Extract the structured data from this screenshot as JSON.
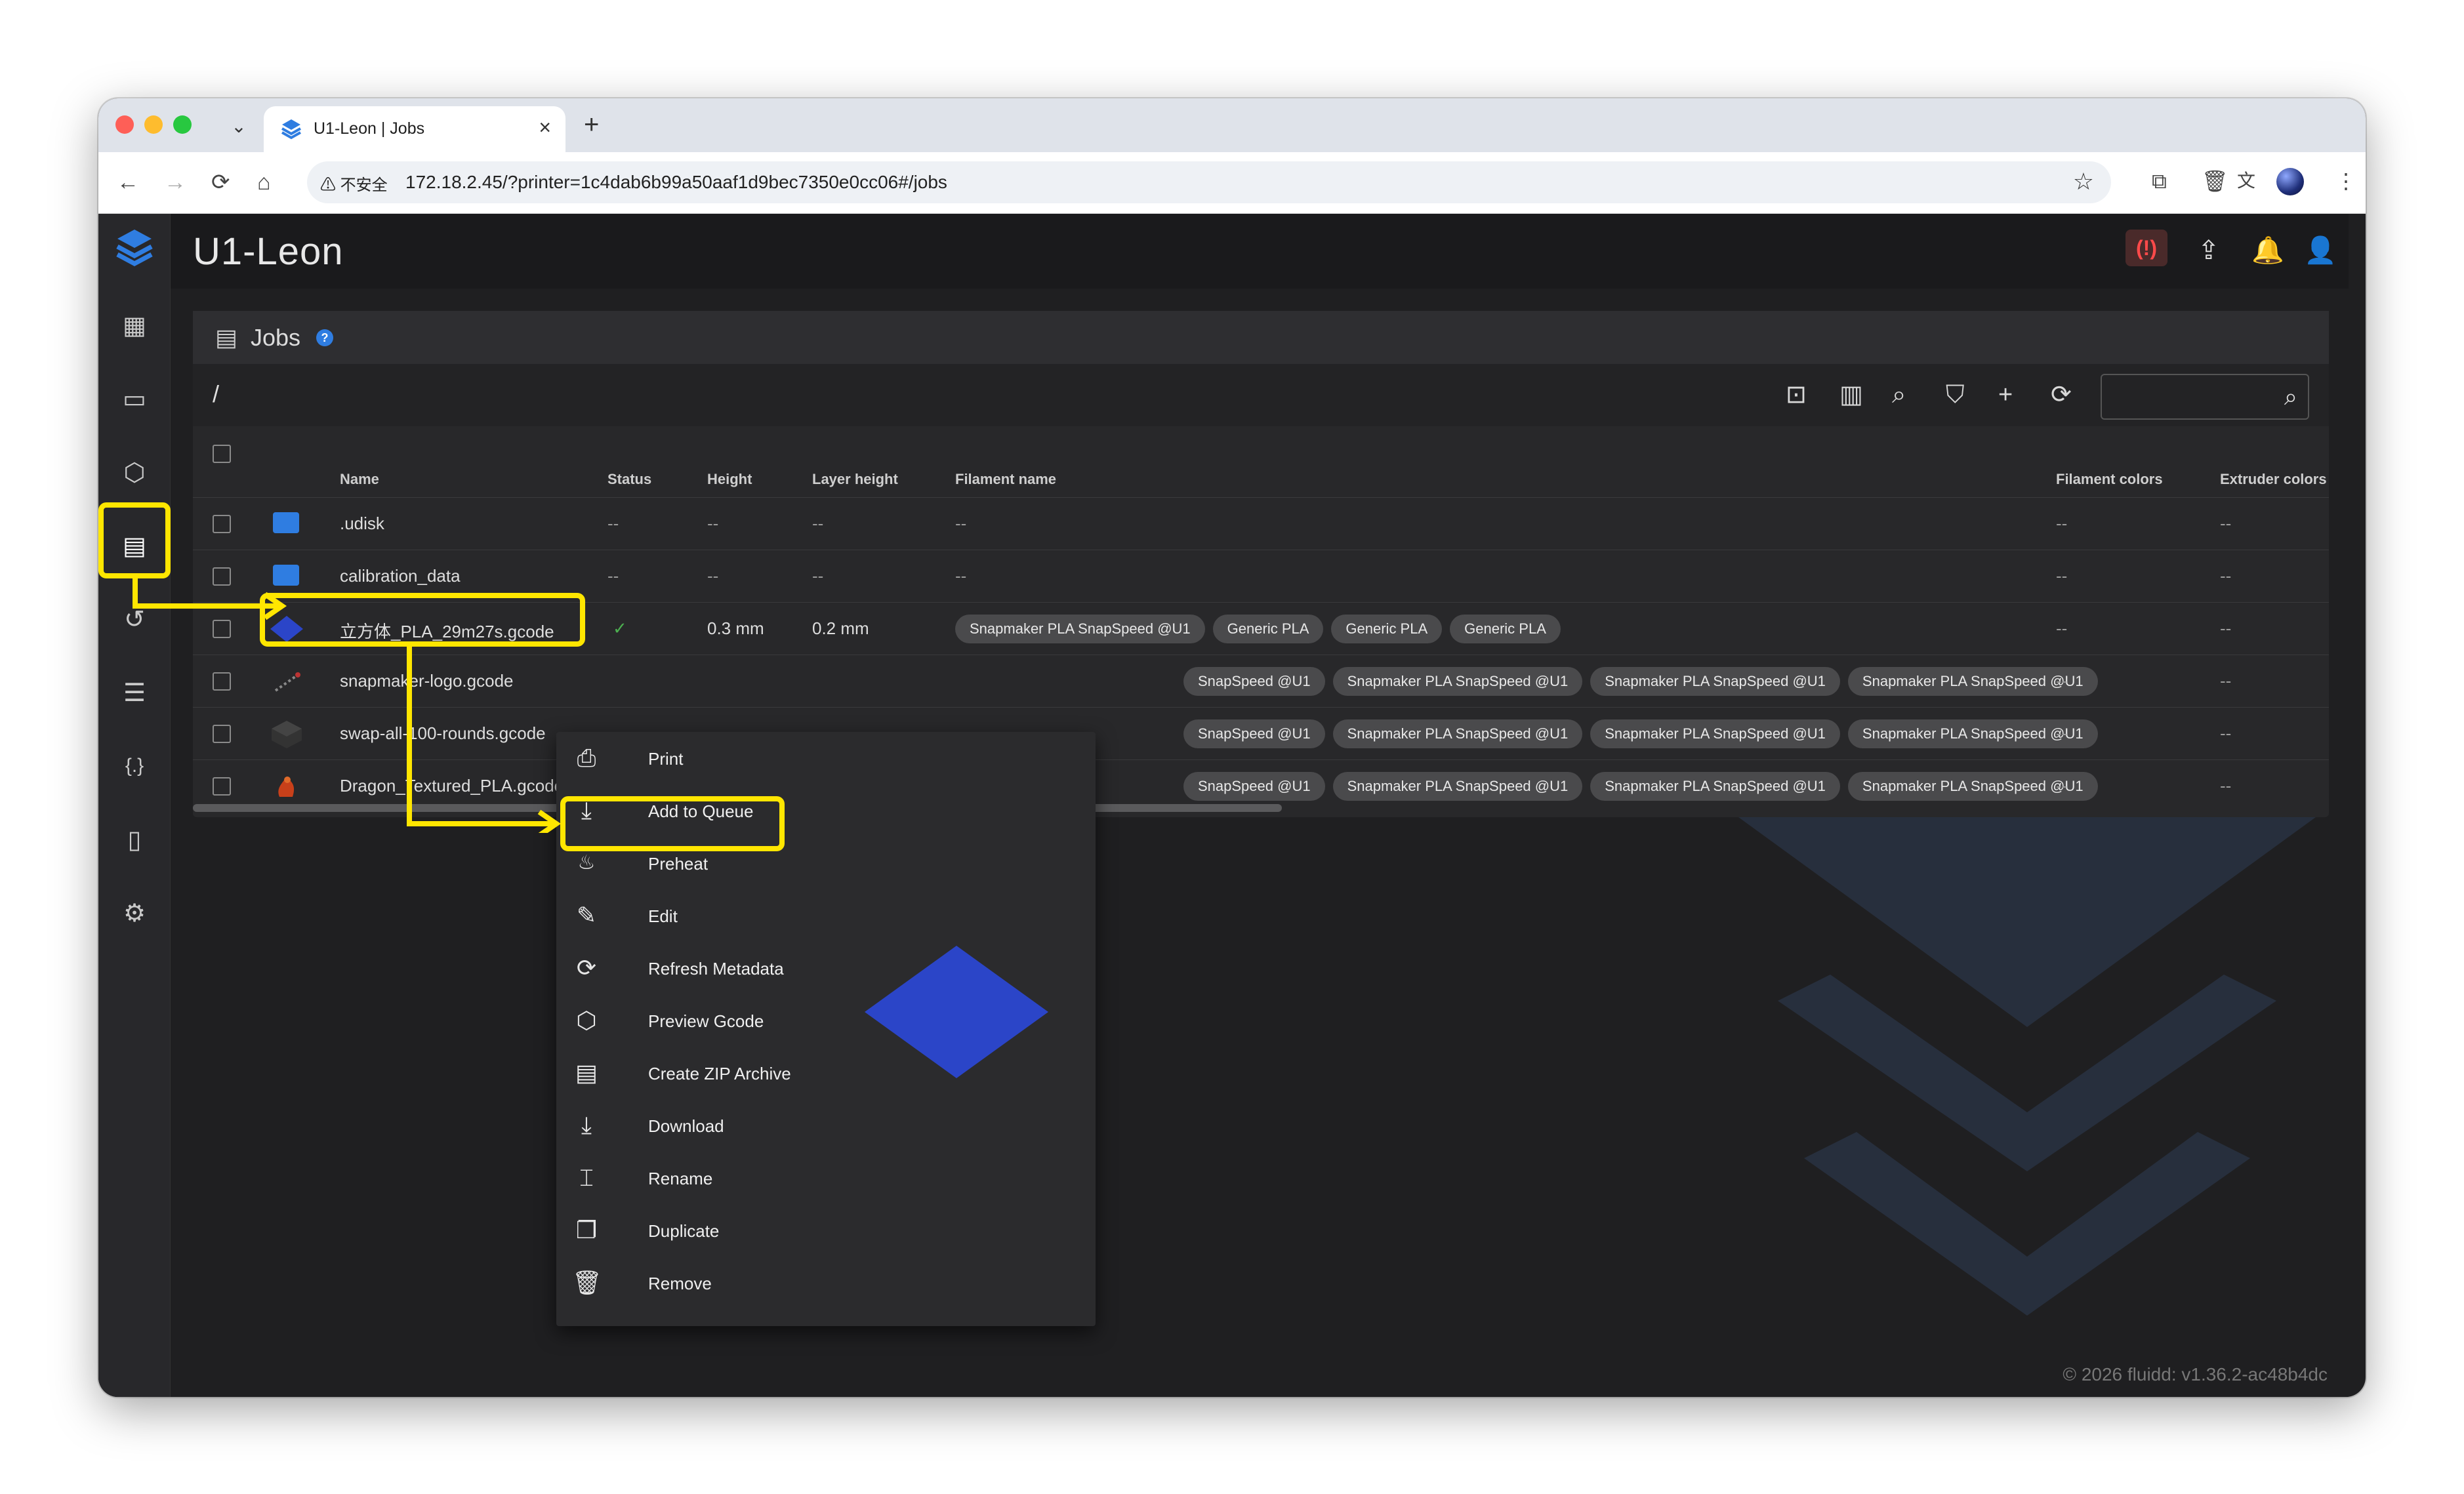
{
  "browser": {
    "tab_title": "U1-Leon | Jobs",
    "tab_close": "×",
    "new_tab": "+",
    "insecure_label": "⚠ 不安全",
    "url": "172.18.2.45/?printer=1c4dab6b99a50aaf1d9bec7350e0cc06#/jobs",
    "colors": {
      "red": "#fe5f57",
      "yellow": "#febc2e",
      "green": "#28c840"
    }
  },
  "app": {
    "title": "U1-Leon",
    "estop_icon": "emergency-stop-icon",
    "footer": "© 2026 fluidd: v1.36.2-ac48b4dc"
  },
  "sidebar": {
    "items": [
      {
        "name": "dashboard-icon"
      },
      {
        "name": "console-icon"
      },
      {
        "name": "gcode-preview-icon"
      },
      {
        "name": "jobs-icon",
        "active": true
      },
      {
        "name": "history-icon"
      },
      {
        "name": "tune-icon"
      },
      {
        "name": "macros-icon",
        "glyph": "{.}"
      },
      {
        "name": "printer-icon"
      },
      {
        "name": "settings-icon"
      }
    ]
  },
  "jobs": {
    "title": "Jobs",
    "help": "?",
    "path": "/",
    "columns": [
      "Name",
      "Status",
      "Height",
      "Layer height",
      "Filament name",
      "Filament colors",
      "Extruder colors"
    ],
    "rows": [
      {
        "name": ".udisk",
        "status": "--",
        "height": "--",
        "layer": "--",
        "filament": "--",
        "fcolors": "--",
        "ecolors": "--",
        "type": "folder"
      },
      {
        "name": "calibration_data",
        "status": "--",
        "height": "--",
        "layer": "--",
        "filament": "--",
        "fcolors": "--",
        "ecolors": "--",
        "type": "folder"
      },
      {
        "name": "立方体_PLA_29m27s.gcode",
        "status": "✓",
        "height": "0.3 mm",
        "layer": "0.2 mm",
        "chips": [
          "Snapmaker PLA SnapSpeed @U1",
          "Generic PLA",
          "Generic PLA",
          "Generic PLA"
        ],
        "fcolors": "--",
        "ecolors": "--",
        "type": "cube"
      },
      {
        "name": "snapmaker-logo.gcode",
        "chips": [
          "SnapSpeed @U1",
          "Snapmaker PLA SnapSpeed @U1",
          "Snapmaker PLA SnapSpeed @U1",
          "Snapmaker PLA SnapSpeed @U1"
        ],
        "fcolors": "--",
        "ecolors": "--",
        "type": "logo"
      },
      {
        "name": "swap-all-100-rounds.gcode",
        "chips": [
          "SnapSpeed @U1",
          "Snapmaker PLA SnapSpeed @U1",
          "Snapmaker PLA SnapSpeed @U1",
          "Snapmaker PLA SnapSpeed @U1"
        ],
        "fcolors": "--",
        "ecolors": "--",
        "type": "swap"
      },
      {
        "name": "Dragon_Textured_PLA.gcode",
        "chips": [
          "SnapSpeed @U1",
          "Snapmaker PLA SnapSpeed @U1",
          "Snapmaker PLA SnapSpeed @U1",
          "Snapmaker PLA SnapSpeed @U1"
        ],
        "fcolors": "--",
        "ecolors": "--",
        "type": "dragon"
      }
    ]
  },
  "context_menu": {
    "items": [
      {
        "label": "Print",
        "icon": "printer-icon",
        "glyph": "⎙"
      },
      {
        "label": "Add to Queue",
        "icon": "add-to-queue-icon",
        "glyph": "⤓"
      },
      {
        "label": "Preheat",
        "icon": "fire-icon",
        "glyph": "🔥"
      },
      {
        "label": "Edit",
        "icon": "pencil-icon",
        "glyph": "✎"
      },
      {
        "label": "Refresh Metadata",
        "icon": "refresh-icon",
        "glyph": "⟳"
      },
      {
        "label": "Preview Gcode",
        "icon": "preview-icon",
        "glyph": "⬡"
      },
      {
        "label": "Create ZIP Archive",
        "icon": "archive-icon",
        "glyph": "▤"
      },
      {
        "label": "Download",
        "icon": "download-icon",
        "glyph": "⤓"
      },
      {
        "label": "Rename",
        "icon": "rename-icon",
        "glyph": "⌶"
      },
      {
        "label": "Duplicate",
        "icon": "duplicate-icon",
        "glyph": "❐"
      },
      {
        "label": "Remove",
        "icon": "trash-icon",
        "glyph": "🗑"
      }
    ]
  },
  "annotation_color": "#ffe600"
}
